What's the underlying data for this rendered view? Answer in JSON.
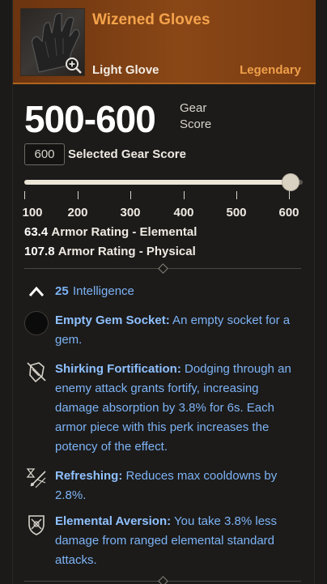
{
  "item": {
    "name": "Wizened Gloves",
    "type": "Light Glove",
    "rarity": "Legendary",
    "icon": "leather-glove-image",
    "zoom_icon": "magnifier-plus-icon"
  },
  "gear_score": {
    "range": "500-600",
    "label_line1": "Gear",
    "label_line2": "Score",
    "selected_value": "600",
    "selected_label": "Selected Gear Score",
    "slider_level": 1.0,
    "ticks": [
      "100",
      "200",
      "300",
      "400",
      "500",
      "600"
    ]
  },
  "armor": [
    {
      "value": "63.4",
      "label": "Armor Rating - Elemental"
    },
    {
      "value": "107.8",
      "label": "Armor Rating - Physical"
    }
  ],
  "attribute": {
    "value": "25",
    "name": "Intelligence"
  },
  "perks": [
    {
      "icon": "empty-gem-socket-icon",
      "title": "Empty Gem Socket:",
      "text": " An empty socket for a gem."
    },
    {
      "icon": "shield-fortify-icon",
      "title": "Shirking Fortification:",
      "text": " Dodging through an enemy attack grants fortify, increasing damage absorption by 3.8% for 6s. Each armor piece with this perk increases the potency of the effect."
    },
    {
      "icon": "hourglass-refresh-icon",
      "title": "Refreshing:",
      "text": " Reduces max cooldowns by 2.8%."
    },
    {
      "icon": "elemental-shield-icon",
      "title": "Elemental Aversion:",
      "text": " You take 3.8% less damage from ranged elemental standard attacks."
    }
  ],
  "colors": {
    "header_bg": "#7a3c12",
    "title_orange": "#f5a34b",
    "perk_blue": "#7db3f5",
    "panel_bg": "#1c1b1a"
  }
}
